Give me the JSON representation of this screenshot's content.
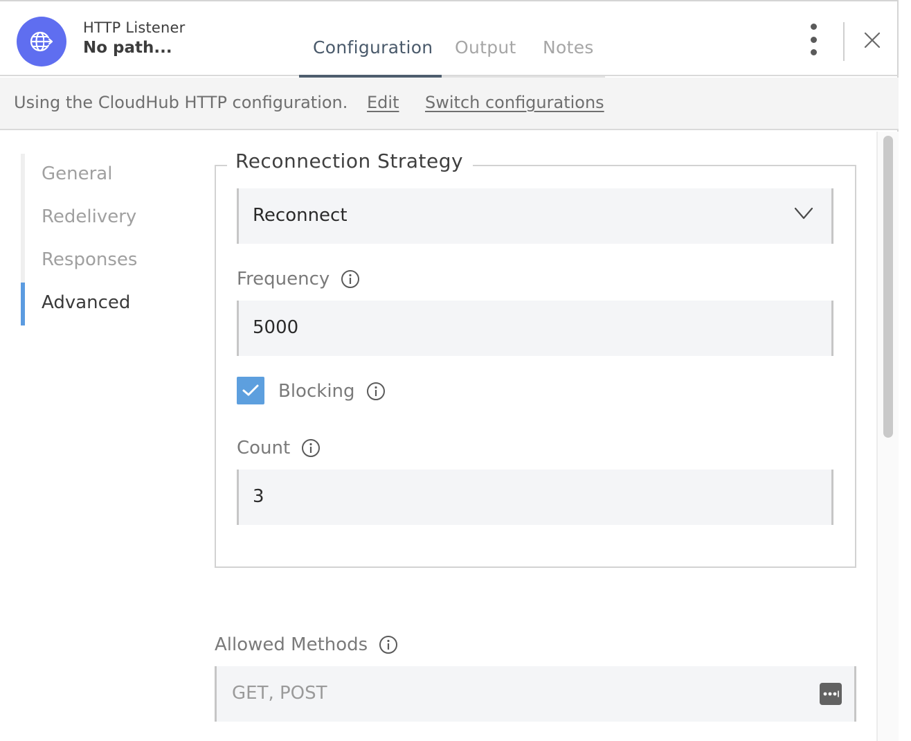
{
  "header": {
    "component_name": "HTTP Listener",
    "component_path": "No path...",
    "icon": "globe-arrow-icon",
    "accent_color": "#5f6ef0",
    "tabs": [
      {
        "label": "Configuration",
        "active": true
      },
      {
        "label": "Output",
        "active": false
      },
      {
        "label": "Notes",
        "active": false
      }
    ]
  },
  "config_bar": {
    "text": "Using the CloudHub HTTP configuration.",
    "edit_label": "Edit",
    "switch_label": "Switch configurations"
  },
  "sidenav": {
    "items": [
      {
        "label": "General",
        "active": false
      },
      {
        "label": "Redelivery",
        "active": false
      },
      {
        "label": "Responses",
        "active": false
      },
      {
        "label": "Advanced",
        "active": true
      }
    ],
    "active_color": "#5b9be0"
  },
  "reconnection": {
    "legend": "Reconnection Strategy",
    "strategy_value": "Reconnect",
    "frequency_label": "Frequency",
    "frequency_value": "5000",
    "blocking_label": "Blocking",
    "blocking_checked": true,
    "count_label": "Count",
    "count_value": "3"
  },
  "allowed_methods": {
    "label": "Allowed Methods",
    "placeholder": "GET, POST"
  },
  "checkbox_color": "#5d9fde"
}
